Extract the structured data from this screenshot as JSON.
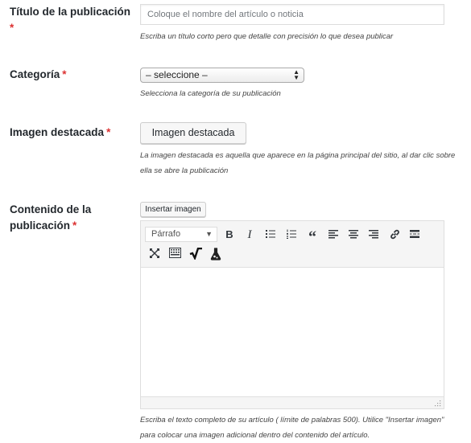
{
  "required_mark": "*",
  "title_field": {
    "label": "Título de la publicación",
    "placeholder": "Coloque el nombre del artículo o noticia",
    "help": "Escriba un título corto pero que detalle con precisión lo que desea publicar"
  },
  "category_field": {
    "label": "Categoría",
    "selected": "– seleccione –",
    "help": "Selecciona la categoría de su publicación"
  },
  "featured_image_field": {
    "label": "Imagen destacada",
    "button": "Imagen destacada",
    "help": "La imagen destacada es aquella que aparece en la página principal del sitio, al dar clic sobre ella se abre la publicación"
  },
  "content_field": {
    "label": "Contenido de la publicación",
    "insert_button": "Insertar imagen",
    "format_select": "Párrafo",
    "toolbar_icons": [
      "bold-icon",
      "italic-icon",
      "bullet-list-icon",
      "numbered-list-icon",
      "blockquote-icon",
      "align-left-icon",
      "align-center-icon",
      "align-right-icon",
      "link-icon",
      "read-more-icon",
      "fullscreen-icon",
      "keyboard-shortcuts-icon",
      "math-formula-icon",
      "chemistry-icon"
    ],
    "bold_glyph": "B",
    "italic_glyph": "I",
    "quote_glyph": "“",
    "help": "Escriba el texto completo de su artículo ( límite de palabras 500). Utilice \"Insertar imagen\" para colocar una imagen adicional dentro del contenido del artículo."
  }
}
